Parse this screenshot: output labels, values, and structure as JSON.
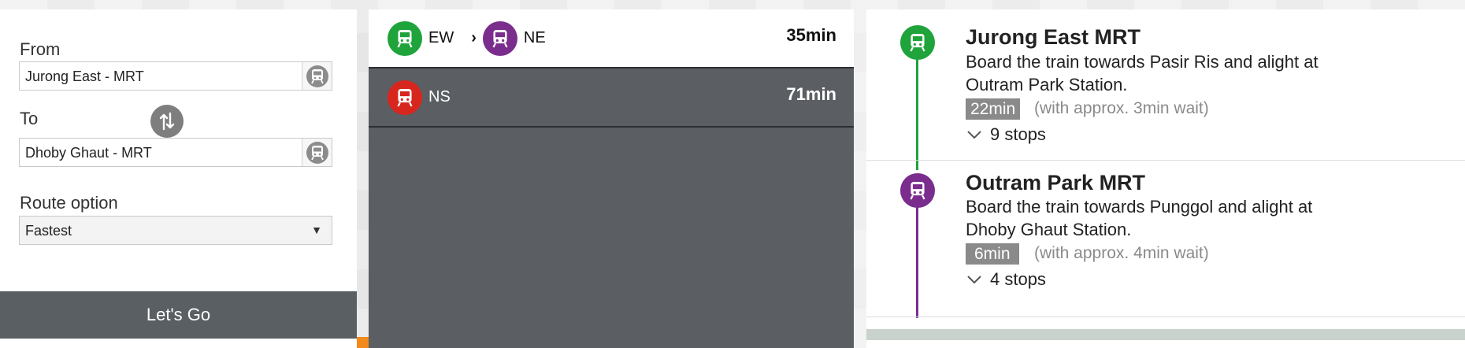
{
  "colors": {
    "ew_line": "#1fa33b",
    "ne_line": "#7b2d8e",
    "ns_line": "#d7261e",
    "go_button": "#5a5f63",
    "accent_orange": "#f28a1c"
  },
  "form": {
    "from_label": "From",
    "from_value": "Jurong East - MRT",
    "to_label": "To",
    "to_value": "Dhoby Ghaut - MRT",
    "route_option_label": "Route option",
    "route_option_value": "Fastest",
    "go_label": "Let's Go",
    "icons": {
      "from_picker": "train-icon",
      "to_picker": "train-icon",
      "swap": "swap-icon",
      "dropdown": "caret-down-icon"
    }
  },
  "routes": [
    {
      "selected": true,
      "legs": [
        {
          "code": "EW",
          "icon": "train-icon"
        },
        {
          "code": "NE",
          "icon": "train-icon"
        }
      ],
      "duration": "35min"
    },
    {
      "selected": false,
      "legs": [
        {
          "code": "NS",
          "icon": "train-icon"
        }
      ],
      "duration": "71min"
    }
  ],
  "details": {
    "legs": [
      {
        "station": "Jurong East MRT",
        "instruction_line1": "Board the train towards Pasir Ris and alight at",
        "instruction_line2": "Outram Park Station.",
        "ride_time": "22min",
        "wait": "(with approx. 3min wait)",
        "stops": "9 stops"
      },
      {
        "station": "Outram Park MRT",
        "instruction_line1": "Board the train towards Punggol and alight at",
        "instruction_line2": "Dhoby Ghaut Station.",
        "ride_time": "6min",
        "wait": "(with approx. 4min wait)",
        "stops": "4 stops"
      }
    ]
  }
}
